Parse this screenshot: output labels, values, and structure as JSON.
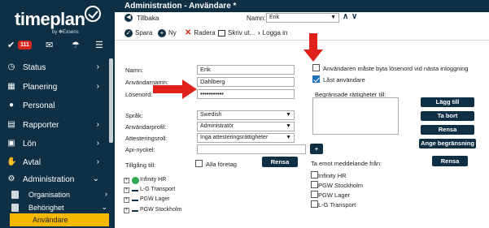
{
  "sidebar": {
    "logo_text": "timeplan",
    "logo_sub": "by ✥Exsens",
    "badge_count": "111",
    "nav": [
      {
        "label": "Status"
      },
      {
        "label": "Planering"
      },
      {
        "label": "Personal"
      },
      {
        "label": "Rapporter"
      },
      {
        "label": "Lön"
      },
      {
        "label": "Avtal"
      },
      {
        "label": "Administration"
      }
    ],
    "sub": [
      {
        "label": "Organisation"
      },
      {
        "label": "Behörighet"
      }
    ],
    "active": "Användare"
  },
  "header": {
    "title": "Administration - Användare *"
  },
  "subbar": {
    "back": "Tillbaka",
    "name_label": "Namn:",
    "name_value": "Erik"
  },
  "toolbar": {
    "save": "Spara",
    "new": "Ny",
    "delete": "Radera",
    "print": "Skriv ut...",
    "logout": "Logga in"
  },
  "form": {
    "name_label": "Namn:",
    "name_value": "Erik",
    "username_label": "Användarnamn:",
    "username_value": "Dahlberg",
    "password_label": "Lösenord:",
    "password_value": "•••••••••••",
    "lang_label": "Språk:",
    "lang_value": "Swedish",
    "profile_label": "Användarprofil:",
    "profile_value": "Administratör",
    "attest_label": "Attesteringsroll:",
    "attest_value": "Inga attesteringsrättigheter",
    "api_label": "Api-nyckel:",
    "api_add": "+",
    "access_label": "Tillgång till:",
    "all_companies": "Alla företag",
    "clear": "Rensa"
  },
  "right": {
    "must_change": "Användaren måste byta lösenord vid nästa inloggning",
    "locked": "Låst användare",
    "restrict_label": "Begränsade rättigheter till:",
    "add": "Lägg till",
    "remove": "Ta bort",
    "clear": "Rensa",
    "set_restrict": "Ange begränsning",
    "receive_label": "Ta emot meddelande från:",
    "receive_clear": "Rensa",
    "receive_items": [
      "Infinity HR",
      "PGW Stockholm",
      "PGW Lager",
      "L-G Transport"
    ]
  },
  "tree": [
    {
      "label": "Infinity HR"
    },
    {
      "label": "L-G Transport"
    },
    {
      "label": "PGW Lager"
    },
    {
      "label": "PGW Stockholm"
    }
  ],
  "colors": {
    "navy": "#0e2f44",
    "accent": "#f5b700",
    "red": "#d7261e"
  }
}
